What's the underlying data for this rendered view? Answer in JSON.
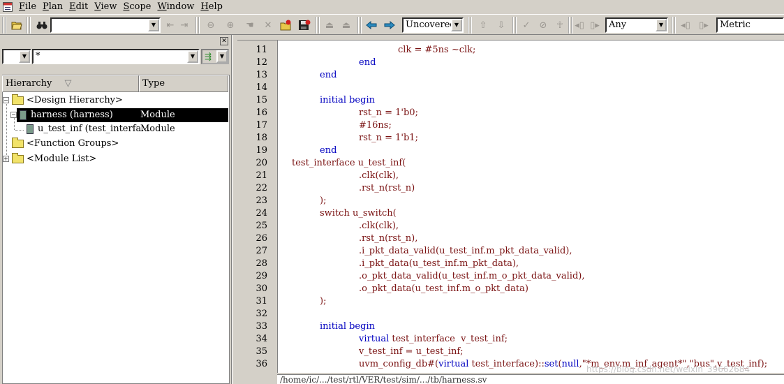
{
  "menubar": {
    "items": [
      {
        "first": "F",
        "rest": "ile"
      },
      {
        "first": "P",
        "rest": "lan"
      },
      {
        "first": "E",
        "rest": "dit"
      },
      {
        "first": "V",
        "rest": "iew"
      },
      {
        "first": "S",
        "rest": "cope"
      },
      {
        "first": "W",
        "rest": "indow"
      },
      {
        "first": "H",
        "rest": "elp"
      }
    ]
  },
  "toolbar": {
    "search_value": "",
    "coverage_filter": "Uncovered",
    "any_filter": "Any",
    "metric_filter": "Metric",
    "icons": [
      "open-folder-icon",
      "binoculars-icon",
      "find-prev-icon",
      "find-next-icon",
      "minus-circle-icon",
      "plus-circle-icon",
      "hand-icon",
      "delete-icon",
      "load-icon",
      "save-icon",
      "arrow-left-icon",
      "arrow-right-icon"
    ]
  },
  "left_panel": {
    "scope_value": "",
    "filter_value": "*",
    "columns": {
      "hierarchy": "Hierarchy",
      "type": "Type"
    },
    "tree": [
      {
        "label": "<Design Hierarchy>",
        "type": ""
      },
      {
        "label": "harness (harness)",
        "type": "Module"
      },
      {
        "label": "u_test_inf (test_interfa…",
        "type": "Module"
      },
      {
        "label": "<Function Groups>",
        "type": ""
      },
      {
        "label": "<Module List>",
        "type": ""
      }
    ]
  },
  "editor": {
    "line_numbers": [
      "11",
      "12",
      "13",
      "14",
      "15",
      "16",
      "17",
      "18",
      "19",
      "20",
      "21",
      "22",
      "23",
      "24",
      "25",
      "26",
      "27",
      "28",
      "29",
      "30",
      "31",
      "32",
      "33",
      "34",
      "35",
      "36"
    ],
    "lines": [
      {
        "indent": 172,
        "parts": [
          {
            "t": "clk = #5ns ~clk;",
            "k": false
          }
        ]
      },
      {
        "indent": 116,
        "parts": [
          {
            "t": "end",
            "k": true
          }
        ]
      },
      {
        "indent": 60,
        "parts": [
          {
            "t": "end",
            "k": true
          }
        ]
      },
      {
        "indent": 0,
        "parts": []
      },
      {
        "indent": 60,
        "parts": [
          {
            "t": "initial begin",
            "k": true
          }
        ]
      },
      {
        "indent": 116,
        "parts": [
          {
            "t": "rst_n = 1'b0;",
            "k": false
          }
        ]
      },
      {
        "indent": 116,
        "parts": [
          {
            "t": "#16ns;",
            "k": false
          }
        ]
      },
      {
        "indent": 116,
        "parts": [
          {
            "t": "rst_n = 1'b1;",
            "k": false
          }
        ]
      },
      {
        "indent": 60,
        "parts": [
          {
            "t": "end",
            "k": true
          }
        ]
      },
      {
        "indent": 20,
        "parts": [
          {
            "t": "test_interface u_test_inf(",
            "k": false
          }
        ]
      },
      {
        "indent": 116,
        "parts": [
          {
            "t": ".clk(clk),",
            "k": false
          }
        ]
      },
      {
        "indent": 116,
        "parts": [
          {
            "t": ".rst_n(rst_n)",
            "k": false
          }
        ]
      },
      {
        "indent": 60,
        "parts": [
          {
            "t": ");",
            "k": false
          }
        ]
      },
      {
        "indent": 60,
        "parts": [
          {
            "t": "switch u_switch(",
            "k": false
          }
        ]
      },
      {
        "indent": 116,
        "parts": [
          {
            "t": ".clk(clk),",
            "k": false
          }
        ]
      },
      {
        "indent": 116,
        "parts": [
          {
            "t": ".rst_n(rst_n),",
            "k": false
          }
        ]
      },
      {
        "indent": 116,
        "parts": [
          {
            "t": ".i_pkt_data_valid(u_test_inf.m_pkt_data_valid),",
            "k": false
          }
        ]
      },
      {
        "indent": 116,
        "parts": [
          {
            "t": ".i_pkt_data(u_test_inf.m_pkt_data),",
            "k": false
          }
        ]
      },
      {
        "indent": 116,
        "parts": [
          {
            "t": ".o_pkt_data_valid(u_test_inf.m_o_pkt_data_valid),",
            "k": false
          }
        ]
      },
      {
        "indent": 116,
        "parts": [
          {
            "t": ".o_pkt_data(u_test_inf.m_o_pkt_data)",
            "k": false
          }
        ]
      },
      {
        "indent": 60,
        "parts": [
          {
            "t": ");",
            "k": false
          }
        ]
      },
      {
        "indent": 0,
        "parts": []
      },
      {
        "indent": 60,
        "parts": [
          {
            "t": "initial begin",
            "k": true
          }
        ]
      },
      {
        "indent": 116,
        "parts": [
          {
            "t": "virtual",
            "k": true
          },
          {
            "t": " test_interface  v_test_inf;",
            "k": false
          }
        ]
      },
      {
        "indent": 116,
        "parts": [
          {
            "t": "v_test_inf = u_test_inf;",
            "k": false
          }
        ]
      },
      {
        "indent": 116,
        "parts": [
          {
            "t": "uvm_config_db#(",
            "k": false
          },
          {
            "t": "virtual",
            "k": true
          },
          {
            "t": " test_interface)::",
            "k": false
          },
          {
            "t": "set",
            "k": true
          },
          {
            "t": "(",
            "k": false
          },
          {
            "t": "null",
            "k": true
          },
          {
            "t": ",\"*m_env.m_inf_agent*\",\"bus\",v_test_inf);",
            "k": false
          }
        ]
      }
    ],
    "file_path": "/home/ic/.../test/rtl/VER/test/sim/.../tb/harness.sv",
    "watermark": "https://blog.csdn.net/weixin_39662684"
  }
}
